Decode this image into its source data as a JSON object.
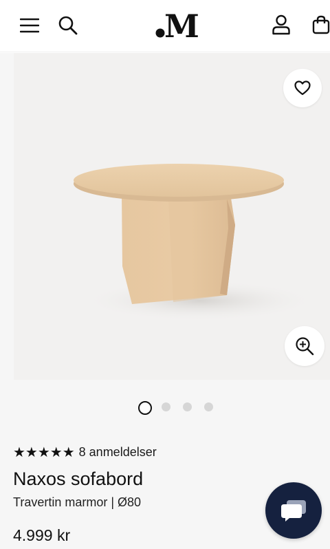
{
  "header": {
    "menu_icon": "hamburger-menu-icon",
    "search_icon": "search-icon",
    "logo_text": ".M",
    "account_icon": "user-icon",
    "cart_icon": "shopping-bag-icon"
  },
  "gallery": {
    "favorite_icon": "heart-icon",
    "zoom_icon": "zoom-in-icon",
    "image_alt": "Naxos sofabord",
    "total_images": 4,
    "active_index": 0
  },
  "product": {
    "rating_stars": "★★★★★",
    "rating_value": 5,
    "reviews_label": "8 anmeldelser",
    "title": "Naxos sofabord",
    "subtitle": "Travertin marmor | Ø80",
    "price": "4.999 kr"
  },
  "chat": {
    "icon": "chat-bubble-icon"
  },
  "colors": {
    "text": "#1a1a1a",
    "background": "#f6f6f6",
    "chat_button": "#15213f",
    "travertine": "#e8c9a4"
  }
}
